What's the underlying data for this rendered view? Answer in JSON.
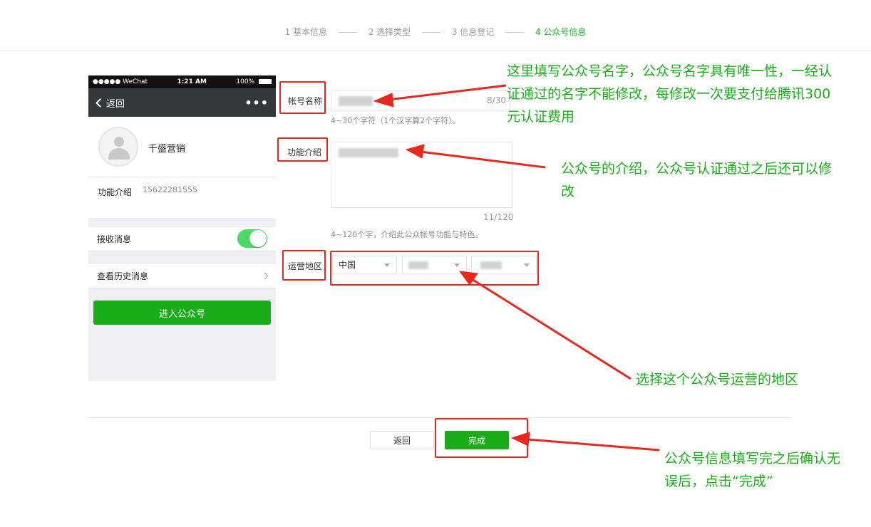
{
  "stepper": {
    "steps": [
      "1 基本信息",
      "2 选择类型",
      "3 信息登记",
      "4 公众号信息"
    ],
    "active_index": 3
  },
  "phone": {
    "status": {
      "carrier": "●●●●● WeChat",
      "time": "1:21 AM",
      "battery": "100%"
    },
    "back_label": "返回",
    "more_label": "•••",
    "account_name": "千盛营销",
    "intro_label": "功能介绍",
    "intro_value": "15622281555",
    "receive_label": "接收消息",
    "receive_on": true,
    "history_label": "查看历史消息",
    "enter_button": "进入公众号"
  },
  "form": {
    "name_label": "帐号名称",
    "name_counter": "8/30",
    "name_hint": "4~30个字符（1个汉字算2个字符）。",
    "intro_label": "功能介绍",
    "intro_counter": "11/120",
    "intro_hint": "4~120个字，介绍此公众帐号功能与特色。",
    "region_label": "运营地区",
    "country": "中国"
  },
  "actions": {
    "back": "返回",
    "done": "完成"
  },
  "annotations": {
    "name": [
      "这里填写公众号名字，公众号名字具有唯一性，一经认",
      "证通过的名字不能修改，每修改一次要支付给腾讯300",
      "元认证费用"
    ],
    "intro": [
      "公众号的介绍，公众号认证通过之后还可以修",
      "改"
    ],
    "region": [
      "选择这个公众号运营的地区"
    ],
    "done": [
      "公众号信息填写完之后确认无",
      "误后，点击“完成”"
    ]
  },
  "colors": {
    "accent": "#1aad19",
    "highlight": "#e8281f",
    "annotation_text": "#1aad19"
  }
}
